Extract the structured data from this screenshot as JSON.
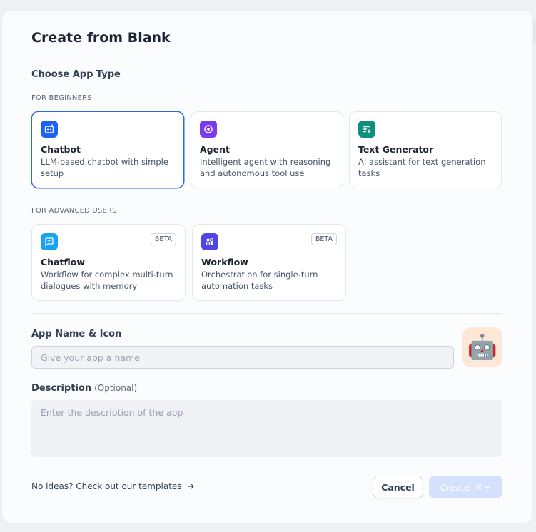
{
  "modal": {
    "title": "Create from Blank",
    "section_title": "Choose App Type"
  },
  "groups": {
    "beginners_label": "FOR BEGINNERS",
    "advanced_label": "FOR ADVANCED USERS"
  },
  "app_types": {
    "chatbot": {
      "name": "Chatbot",
      "desc": "LLM-based chatbot with simple setup",
      "icon": "chatbot-icon",
      "color": "#1e63f0",
      "selected": true
    },
    "agent": {
      "name": "Agent",
      "desc": "Intelligent agent with reasoning and autonomous tool use",
      "icon": "agent-icon",
      "color": "#7c3aed"
    },
    "text_generator": {
      "name": "Text Generator",
      "desc": "AI assistant for text generation tasks",
      "icon": "text-generator-icon",
      "color": "#0f8f7f"
    },
    "chatflow": {
      "name": "Chatflow",
      "desc": "Workflow for complex multi-turn dialogues with memory",
      "icon": "chatflow-icon",
      "color": "#16a3f0",
      "badge": "BETA"
    },
    "workflow": {
      "name": "Workflow",
      "desc": "Orchestration for single-turn automation tasks",
      "icon": "workflow-icon",
      "color": "#4f46e5",
      "badge": "BETA"
    }
  },
  "form": {
    "name_label": "App Name & Icon",
    "name_placeholder": "Give your app a name",
    "name_value": "",
    "app_icon": "🤖",
    "description_label": "Description",
    "description_optional": "(Optional)",
    "description_placeholder": "Enter the description of the app",
    "description_value": ""
  },
  "footer": {
    "templates_link": "No ideas? Check out our templates",
    "cancel_label": "Cancel",
    "create_label": "Create",
    "create_shortcut": "⌘ ↵"
  },
  "colors": {
    "accent": "#2e67e8",
    "create_disabled_bg": "#d3e1fc",
    "app_icon_bg": "#fde7d6"
  }
}
